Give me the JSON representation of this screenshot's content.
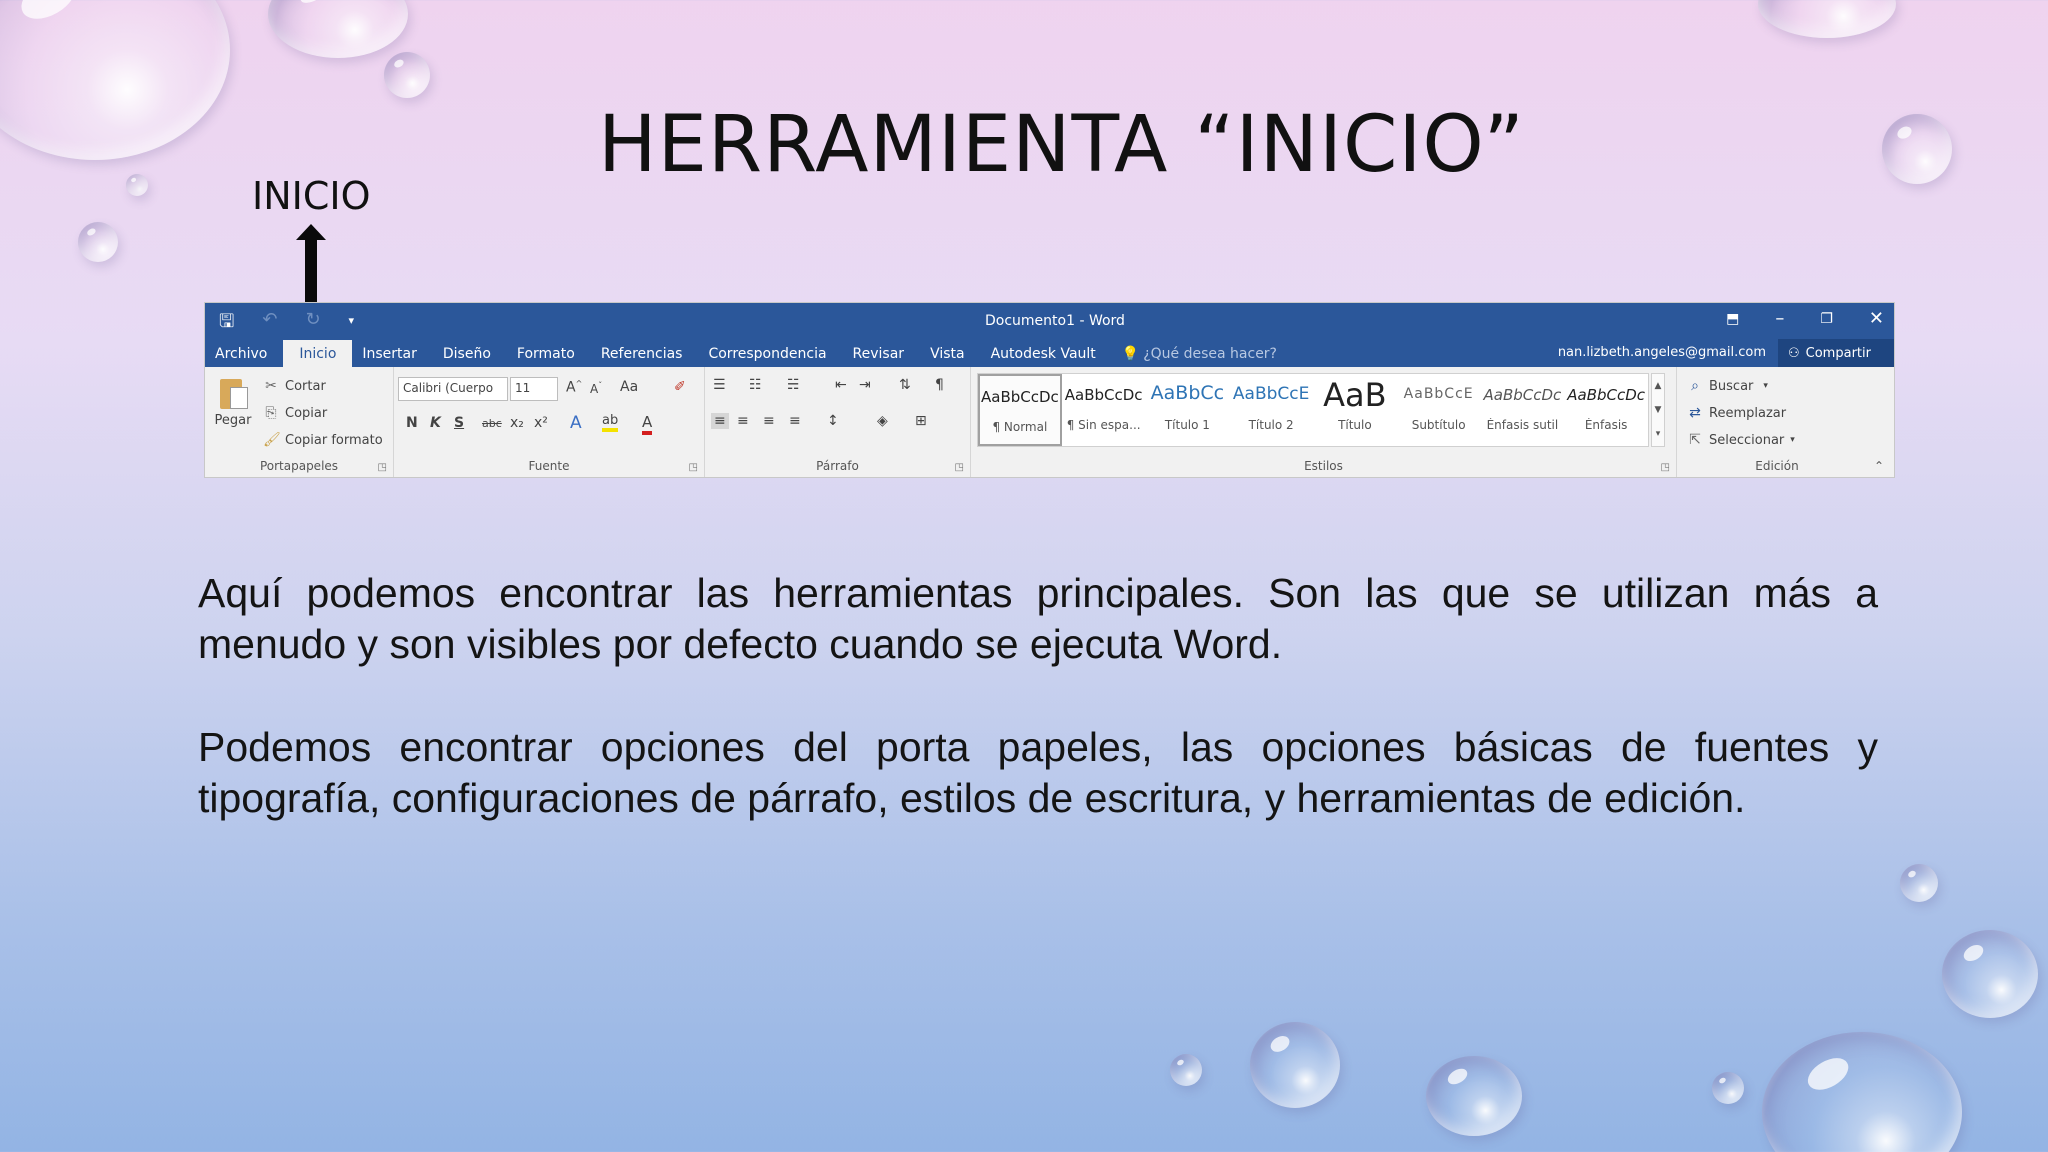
{
  "slide": {
    "title": "HERRAMIENTA “INICIO”",
    "label": "INICIO",
    "paragraphs": [
      "Aquí podemos encontrar las herramientas principales. Son las que se utilizan más a menudo y son visibles por defecto cuando se ejecuta Word.",
      "Podemos encontrar opciones del porta papeles, las opciones básicas de fuentes y tipografía, configuraciones de párrafo, estilos de escritura, y herramientas de edición."
    ]
  },
  "word": {
    "doc_title": "Documento1 - Word",
    "account": "nan.lizbeth.angeles@gmail.com",
    "share": "Compartir",
    "tell_me": "¿Qué desea hacer?",
    "tabs": [
      "Archivo",
      "Inicio",
      "Insertar",
      "Diseño",
      "Formato",
      "Referencias",
      "Correspondencia",
      "Revisar",
      "Vista",
      "Autodesk Vault"
    ],
    "colors": {
      "titlebar": "#2b579a",
      "ribbon": "#f1f1f1"
    },
    "clipboard": {
      "paste": "Pegar",
      "cut": "Cortar",
      "copy": "Copiar",
      "format_painter": "Copiar formato",
      "label": "Portapapeles"
    },
    "font": {
      "name": "Calibri (Cuerpo",
      "size": "11",
      "case": "Aa",
      "bold": "N",
      "italic": "K",
      "underline": "S",
      "strike": "abc",
      "sub": "x₂",
      "sup": "x²",
      "label": "Fuente"
    },
    "paragraph": {
      "label": "Párrafo"
    },
    "styles": {
      "items": [
        {
          "sample": "AaBbCcDc",
          "name": "¶ Normal"
        },
        {
          "sample": "AaBbCcDc",
          "name": "¶ Sin espa..."
        },
        {
          "sample": "AaBbCc",
          "name": "Título 1"
        },
        {
          "sample": "AaBbCcE",
          "name": "Título 2"
        },
        {
          "sample": "AaB",
          "name": "Título"
        },
        {
          "sample": "AaBbCcE",
          "name": "Subtítulo"
        },
        {
          "sample": "AaBbCcDc",
          "name": "Énfasis sutil"
        },
        {
          "sample": "AaBbCcDc",
          "name": "Énfasis"
        }
      ],
      "label": "Estilos"
    },
    "editing": {
      "find": "Buscar",
      "replace": "Reemplazar",
      "select": "Seleccionar",
      "label": "Edición"
    }
  }
}
